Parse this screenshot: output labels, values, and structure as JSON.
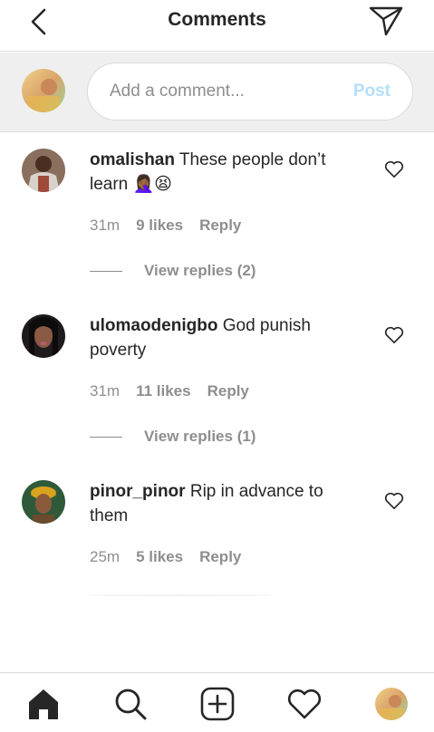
{
  "header": {
    "title": "Comments",
    "back_icon": "chevron-left-icon",
    "share_icon": "direct-send-icon"
  },
  "composer": {
    "placeholder": "Add a comment...",
    "post_label": "Post"
  },
  "comments": [
    {
      "username": "omalishan",
      "text": "These people don’t learn 🤦🏾‍♀️😫",
      "time": "31m",
      "likes": "9 likes",
      "reply_label": "Reply",
      "view_replies": "View replies (2)"
    },
    {
      "username": "ulomaodenigbo",
      "text": "God punish poverty",
      "time": "31m",
      "likes": "11 likes",
      "reply_label": "Reply",
      "view_replies": "View replies (1)"
    },
    {
      "username": "pinor_pinor",
      "text": "Rip in advance to them",
      "time": "25m",
      "likes": "5 likes",
      "reply_label": "Reply"
    }
  ],
  "tabbar": {
    "items": [
      "home-icon",
      "search-icon",
      "add-post-icon",
      "activity-heart-icon",
      "profile-avatar"
    ]
  },
  "colors": {
    "text": "#262626",
    "secondary": "#8e8e8e",
    "post_disabled": "#b2dffc",
    "composer_bg": "#efefef",
    "divider": "#dbdbdb"
  }
}
